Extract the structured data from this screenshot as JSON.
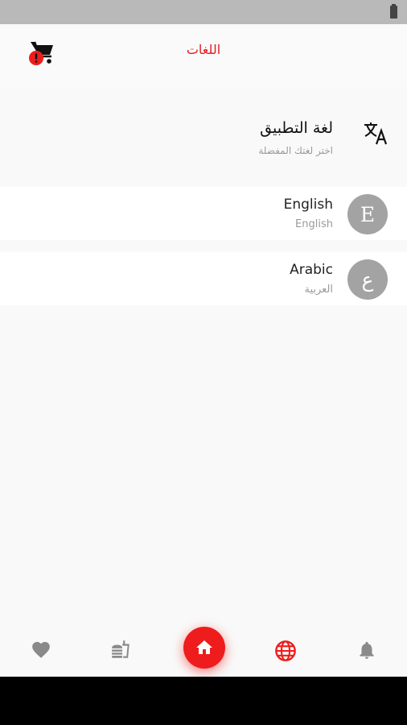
{
  "status_bar": {
    "battery_icon": "battery-icon"
  },
  "app_bar": {
    "title": "اللغات",
    "cart_icon": "cart-alert-icon",
    "accent_color": "#e31b1b"
  },
  "header": {
    "title": "لغة التطبيق",
    "subtitle": "اختر لغتك المفضلة",
    "icon": "translate-icon"
  },
  "languages": [
    {
      "avatar_letter": "E",
      "name": "English",
      "native_name": "English"
    },
    {
      "avatar_letter": "ع",
      "name": "Arabic",
      "native_name": "العربية"
    }
  ],
  "bottom_nav": {
    "items": [
      {
        "icon": "heart-icon",
        "active": false
      },
      {
        "icon": "fast-food-icon",
        "active": false
      },
      {
        "icon": "home-icon",
        "active": true
      },
      {
        "icon": "globe-icon",
        "active": true
      },
      {
        "icon": "bell-icon",
        "active": false
      }
    ],
    "active_color": "#ee1c1c",
    "inactive_color": "#8a8a8a"
  }
}
